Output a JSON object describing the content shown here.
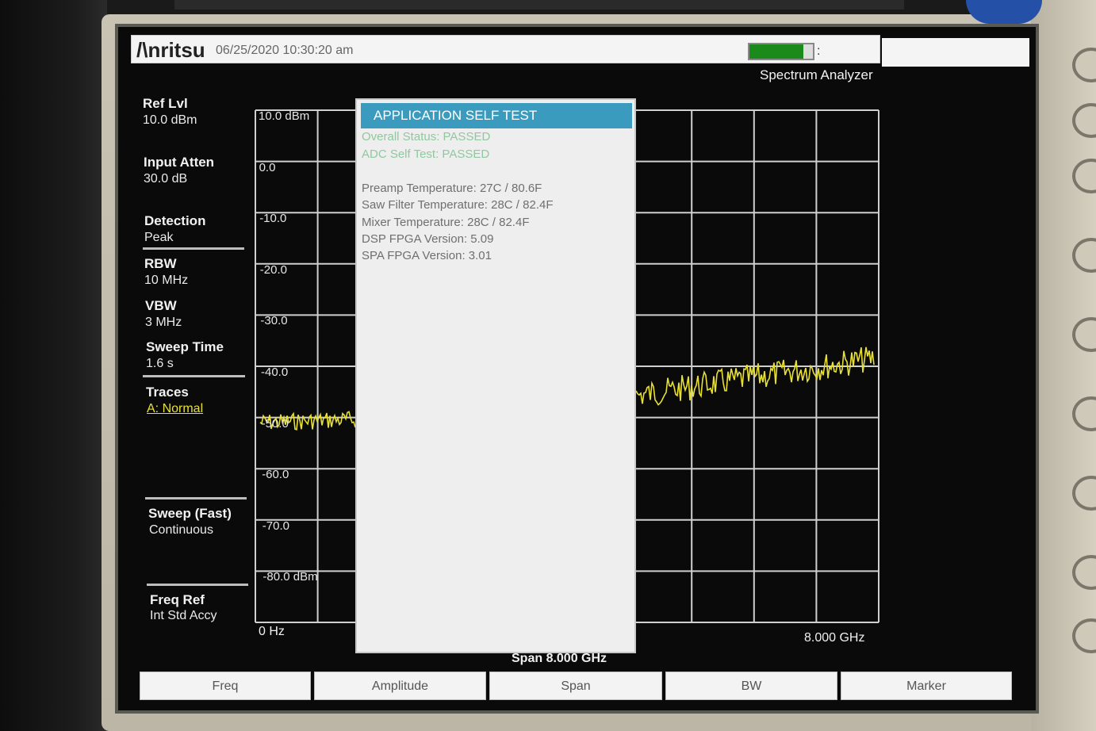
{
  "header": {
    "brand": "/\\nritsu",
    "datetime": "06/25/2020 10:30:20 am",
    "battery_level": 0.85,
    "battery_colon": ":",
    "mode": "Spectrum Analyzer"
  },
  "settings": [
    {
      "label": "Ref Lvl",
      "value": "10.0 dBm"
    },
    {
      "label": "Input Atten",
      "value": "30.0 dB"
    },
    {
      "label": "Detection",
      "value": "Peak"
    },
    {
      "label": "RBW",
      "value": "10 MHz"
    },
    {
      "label": "VBW",
      "value": "3 MHz"
    },
    {
      "label": "Sweep Time",
      "value": "1.6 s"
    },
    {
      "label": "Traces",
      "value": "A: Normal"
    },
    {
      "label": "Sweep (Fast)",
      "value": "Continuous"
    },
    {
      "label": "Freq Ref",
      "value": "Int Std Accy"
    }
  ],
  "graph": {
    "y_labels": [
      "10.0 dBm",
      "0.0",
      "-10.0",
      "-20.0",
      "-30.0",
      "-40.0",
      "-50.0",
      "-60.0",
      "-70.0",
      "-80.0 dBm"
    ],
    "x_start": "0 Hz",
    "x_stop": "8.000 GHz",
    "span_label": "Span 8.000 GHz",
    "trace_color": "#e8e030"
  },
  "dialog": {
    "title": "APPLICATION SELF TEST",
    "status_lines": [
      "Overall Status: PASSED",
      "ADC Self Test: PASSED"
    ],
    "info_lines": [
      "Preamp Temperature: 27C / 80.6F",
      "Saw Filter Temperature: 28C / 82.4F",
      "Mixer Temperature: 28C / 82.4F",
      "DSP FPGA Version: 5.09",
      "SPA FPGA Version: 3.01"
    ]
  },
  "softkeys": [
    "Freq",
    "Amplitude",
    "Span",
    "BW",
    "Marker"
  ],
  "colors": {
    "dialog_title_bg": "#3a9bbf",
    "status_text": "#8fc89f",
    "battery": "#1a8a1a"
  }
}
